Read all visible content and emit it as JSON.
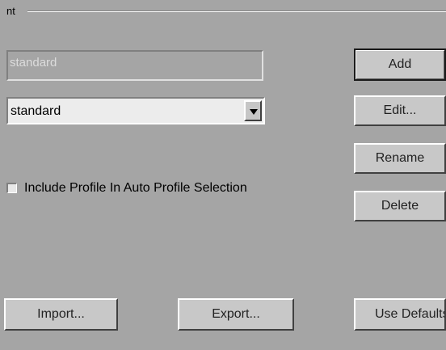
{
  "group": {
    "label": "nt"
  },
  "profile_name_field": {
    "value": "standard"
  },
  "profile_select": {
    "selected": "standard"
  },
  "buttons": {
    "add": "Add",
    "edit": "Edit...",
    "rename": "Rename",
    "delete": "Delete",
    "import": "Import...",
    "export": "Export...",
    "use_defaults": "Use Defaults"
  },
  "auto_profile_checkbox": {
    "label": "Include Profile In Auto Profile Selection",
    "checked": false
  },
  "colors": {
    "background": "#a5a5a5",
    "button_face": "#c8c8c8",
    "combo_bg": "#ececec"
  }
}
